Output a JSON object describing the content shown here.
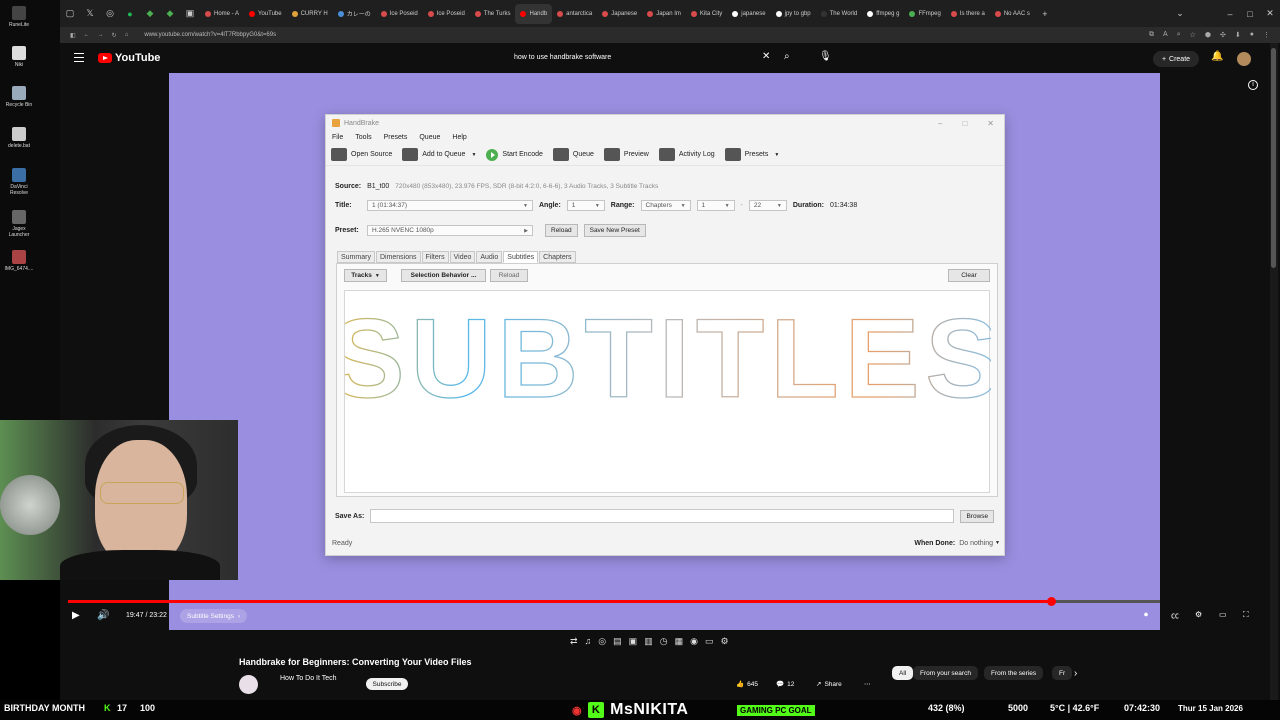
{
  "browser": {
    "tabs": [
      {
        "label": "Home - A",
        "color": "#d94b4b"
      },
      {
        "label": "YouTube",
        "color": "#ff0000"
      },
      {
        "label": "CURRY H",
        "color": "#e0a23b"
      },
      {
        "label": "カレーの",
        "color": "#4a8fd9"
      },
      {
        "label": "Ice Poseid",
        "color": "#d94b4b"
      },
      {
        "label": "Ice Poseid",
        "color": "#d94b4b"
      },
      {
        "label": "The Turks",
        "color": "#d94b4b"
      },
      {
        "label": "Handb",
        "color": "#ff0000"
      },
      {
        "label": "antarctica",
        "color": "#d94b4b"
      },
      {
        "label": "Japanese",
        "color": "#d94b4b"
      },
      {
        "label": "Japan Im",
        "color": "#d94b4b"
      },
      {
        "label": "Kita City",
        "color": "#d94b4b"
      },
      {
        "label": "japanese",
        "color": "#ffffff"
      },
      {
        "label": "jpy to gbp",
        "color": "#ffffff"
      },
      {
        "label": "The World",
        "color": "#333"
      },
      {
        "label": "ffmpeg g",
        "color": "#ffffff"
      },
      {
        "label": "FFmpeg",
        "color": "#4caf50"
      },
      {
        "label": "Is there a",
        "color": "#d94b4b"
      },
      {
        "label": "No AAC s",
        "color": "#d94b4b"
      }
    ],
    "url": "www.youtube.com/watch?v=4lT7RbbpyG0&t=69s"
  },
  "desktop": {
    "icons": [
      "RuneLite",
      "Niki",
      "Recycle Bin",
      "delete.bat",
      "DaVinci Resolve",
      "Jagex Launcher",
      "IMG_6474...."
    ]
  },
  "youtube": {
    "logo": "YouTube",
    "search_query": "how to use handbrake software",
    "create_label": "Create"
  },
  "handbrake": {
    "title": "HandBrake",
    "menu": [
      "File",
      "Tools",
      "Presets",
      "Queue",
      "Help"
    ],
    "toolbar": {
      "open_source": "Open Source",
      "add_to_queue": "Add to Queue",
      "start_encode": "Start Encode",
      "queue": "Queue",
      "preview": "Preview",
      "activity_log": "Activity Log",
      "presets": "Presets"
    },
    "source_label": "Source:",
    "source_name": "B1_t00",
    "source_info": "720x480 (853x480), 23.976 FPS, SDR (8-bit 4:2:0, 6-6-6), 3 Audio Tracks, 3 Subtitle Tracks",
    "title_label": "Title:",
    "title_value": "1 (01:34:37)",
    "angle_label": "Angle:",
    "angle_value": "1",
    "range_label": "Range:",
    "range_type": "Chapters",
    "range_start": "1",
    "range_dash": "-",
    "range_end": "22",
    "duration_label": "Duration:",
    "duration_value": "01:34:38",
    "preset_label": "Preset:",
    "preset_value": "H.265 NVENC 1080p",
    "reload": "Reload",
    "save_new_preset": "Save New Preset",
    "tabs": [
      "Summary",
      "Dimensions",
      "Filters",
      "Video",
      "Audio",
      "Subtitles",
      "Chapters"
    ],
    "active_tab": "Subtitles",
    "tracks_btn": "Tracks",
    "selection_behavior_btn": "Selection Behavior ...",
    "panel_reload": "Reload",
    "clear_btn": "Clear",
    "overlay_text": "SUBTITLES",
    "save_as_label": "Save As:",
    "browse_btn": "Browse",
    "status": "Ready",
    "when_done_label": "When Done:",
    "when_done_value": "Do nothing"
  },
  "player": {
    "time": "19:47 / 23:22",
    "chapter": "Subtitle Settings",
    "progress": 0.9,
    "icons": [
      "play-icon",
      "volume-icon",
      "autoplay-toggle",
      "captions-icon",
      "settings-icon",
      "miniplayer-icon",
      "fullscreen-icon"
    ]
  },
  "video_info": {
    "title": "Handbrake for Beginners: Converting Your Video Files",
    "channel": "How To Do It Tech",
    "subscribe": "Subscribe",
    "likes": "645",
    "comments": "12",
    "share": "Share",
    "chips": [
      "All",
      "From your search",
      "From the series",
      "Fr"
    ]
  },
  "stream": {
    "left_text": "BIRTHDAY MONTH",
    "k_count": "17",
    "percent": "100",
    "name": "MsNIKITA",
    "goal": "GAMING PC GOAL",
    "goal_value": "432 (8%)",
    "count": "5000",
    "weather": "5°C | 42.6°F",
    "clock": "07:42:30",
    "date": "Thur 15 Jan 2026"
  }
}
